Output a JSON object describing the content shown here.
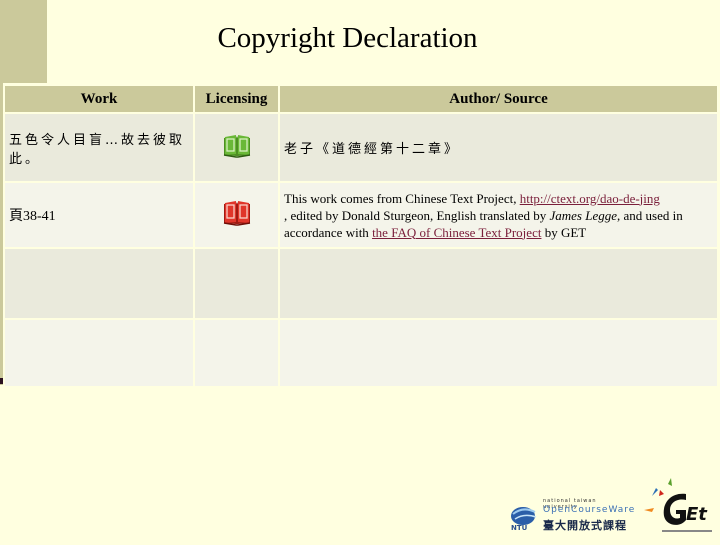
{
  "title": "Copyright Declaration",
  "table": {
    "headers": [
      "Work",
      "Licensing",
      "Author/ Source"
    ],
    "rows": [
      {
        "work": "五色令人目盲…故去彼取此。",
        "license_icon": "green-book-icon",
        "source_text": "老子《道德經第十二章》"
      },
      {
        "work": "頁38-41",
        "license_icon": "red-book-icon",
        "source": {
          "part1": "This work comes from Chinese Text Project, ",
          "link1": "http://ctext.org/dao-de-jing",
          "part2": " , edited by Donald Sturgeon, English translated by ",
          "translator": "James Legge",
          "part3": ", and used in accordance with ",
          "link2": "the FAQ of Chinese Text Project",
          "part4": " by GET"
        }
      },
      {
        "work": "",
        "source_text": ""
      },
      {
        "work": "",
        "source_text": ""
      }
    ]
  },
  "logos": {
    "ocw_small": "national taiwan university",
    "ocw_main": "OpenCourseWare",
    "ocw_cjk": "臺大開放式課程",
    "ocw_ntu": "NTU",
    "get_label": "GET"
  },
  "colors": {
    "background": "#ffffe0",
    "header": "#cbc99b",
    "row_odd": "#eaeadc",
    "row_even": "#f4f4ea",
    "link": "#7a1e3a",
    "book_green": "#5aa02c",
    "book_red": "#d0281e"
  }
}
